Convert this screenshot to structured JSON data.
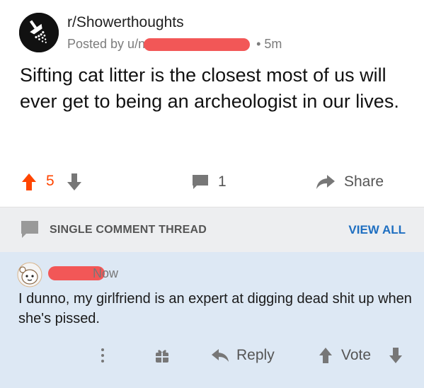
{
  "post": {
    "subreddit": "r/Showerthoughts",
    "posted_by_prefix": "Posted by u/n",
    "time": "• 5m",
    "title": "Sifting cat litter is the closest most of us will ever get to being an archeologist in our lives.",
    "score": "5",
    "comments_count": "1",
    "share_label": "Share",
    "colors": {
      "upvote_active": "#ff4500",
      "redaction": "#f25757"
    }
  },
  "thread": {
    "label": "SINGLE COMMENT THREAD",
    "view_all": "VIEW ALL"
  },
  "comment": {
    "time": "Now",
    "body": "I dunno, my girlfriend is an expert at digging dead shit up when she's pissed.",
    "reply_label": "Reply",
    "vote_label": "Vote",
    "icons": [
      "more-vertical-icon",
      "gift-icon",
      "reply-arrow-icon",
      "upvote-icon",
      "downvote-icon"
    ]
  }
}
